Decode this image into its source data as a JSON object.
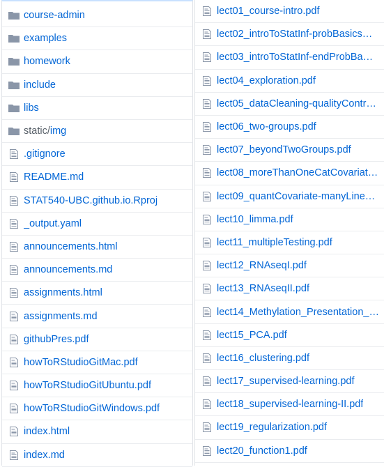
{
  "left_list": [
    {
      "name": "course-admin",
      "type": "folder"
    },
    {
      "name": "examples",
      "type": "folder"
    },
    {
      "name": "homework",
      "type": "folder"
    },
    {
      "name": "include",
      "type": "folder"
    },
    {
      "name": "libs",
      "type": "folder"
    },
    {
      "prefix": "static/",
      "name": "img",
      "type": "folder"
    },
    {
      "name": ".gitignore",
      "type": "file"
    },
    {
      "name": "README.md",
      "type": "file"
    },
    {
      "name": "STAT540-UBC.github.io.Rproj",
      "type": "file"
    },
    {
      "name": "_output.yaml",
      "type": "file"
    },
    {
      "name": "announcements.html",
      "type": "file"
    },
    {
      "name": "announcements.md",
      "type": "file"
    },
    {
      "name": "assignments.html",
      "type": "file"
    },
    {
      "name": "assignments.md",
      "type": "file"
    },
    {
      "name": "githubPres.pdf",
      "type": "file"
    },
    {
      "name": "howToRStudioGitMac.pdf",
      "type": "file"
    },
    {
      "name": "howToRStudioGitUbuntu.pdf",
      "type": "file"
    },
    {
      "name": "howToRStudioGitWindows.pdf",
      "type": "file"
    },
    {
      "name": "index.html",
      "type": "file"
    },
    {
      "name": "index.md",
      "type": "file"
    }
  ],
  "right_list": [
    {
      "name": "lect01_course-intro.pdf",
      "type": "file"
    },
    {
      "name": "lect02_introToStatInf-probBasics…",
      "type": "file"
    },
    {
      "name": "lect03_introToStatInf-endProbBa…",
      "type": "file"
    },
    {
      "name": "lect04_exploration.pdf",
      "type": "file"
    },
    {
      "name": "lect05_dataCleaning-qualityContr…",
      "type": "file"
    },
    {
      "name": "lect06_two-groups.pdf",
      "type": "file"
    },
    {
      "name": "lect07_beyondTwoGroups.pdf",
      "type": "file"
    },
    {
      "name": "lect08_moreThanOneCatCovariat…",
      "type": "file"
    },
    {
      "name": "lect09_quantCovariate-manyLine…",
      "type": "file"
    },
    {
      "name": "lect10_limma.pdf",
      "type": "file"
    },
    {
      "name": "lect11_multipleTesting.pdf",
      "type": "file"
    },
    {
      "name": "lect12_RNAseqI.pdf",
      "type": "file"
    },
    {
      "name": "lect13_RNAseqII.pdf",
      "type": "file"
    },
    {
      "name": "lect14_Methylation_Presentation_…",
      "type": "file"
    },
    {
      "name": "lect15_PCA.pdf",
      "type": "file"
    },
    {
      "name": "lect16_clustering.pdf",
      "type": "file"
    },
    {
      "name": "lect17_supervised-learning.pdf",
      "type": "file"
    },
    {
      "name": "lect18_supervised-learning-II.pdf",
      "type": "file"
    },
    {
      "name": "lect19_regularization.pdf",
      "type": "file"
    },
    {
      "name": "lect20_function1.pdf",
      "type": "file"
    }
  ],
  "colors": {
    "link": "#0366d6",
    "icon": "#8a96a8",
    "border": "#eaecef"
  }
}
